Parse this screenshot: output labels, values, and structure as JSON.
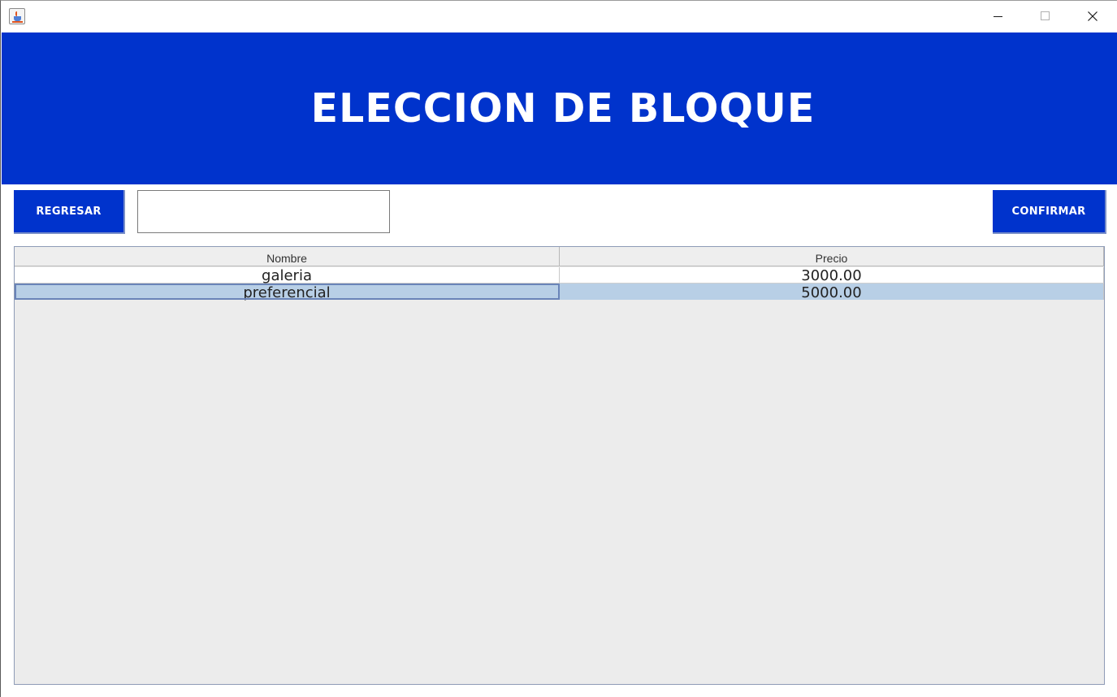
{
  "window": {
    "icon": "java-cup-icon",
    "controls": {
      "minimize": "minimize-icon",
      "maximize": "maximize-icon",
      "close": "close-icon"
    }
  },
  "header": {
    "title": "ELECCION DE BLOQUE",
    "background": "#0033cc"
  },
  "toolbar": {
    "back_label": "REGRESAR",
    "confirm_label": "CONFIRMAR",
    "search_value": ""
  },
  "table": {
    "columns": [
      "Nombre",
      "Precio"
    ],
    "rows": [
      {
        "nombre": "galeria",
        "precio": "3000.00"
      },
      {
        "nombre": "preferencial",
        "precio": "5000.00"
      }
    ],
    "selected_row": 1,
    "selection_color": "#b8cfe6"
  }
}
